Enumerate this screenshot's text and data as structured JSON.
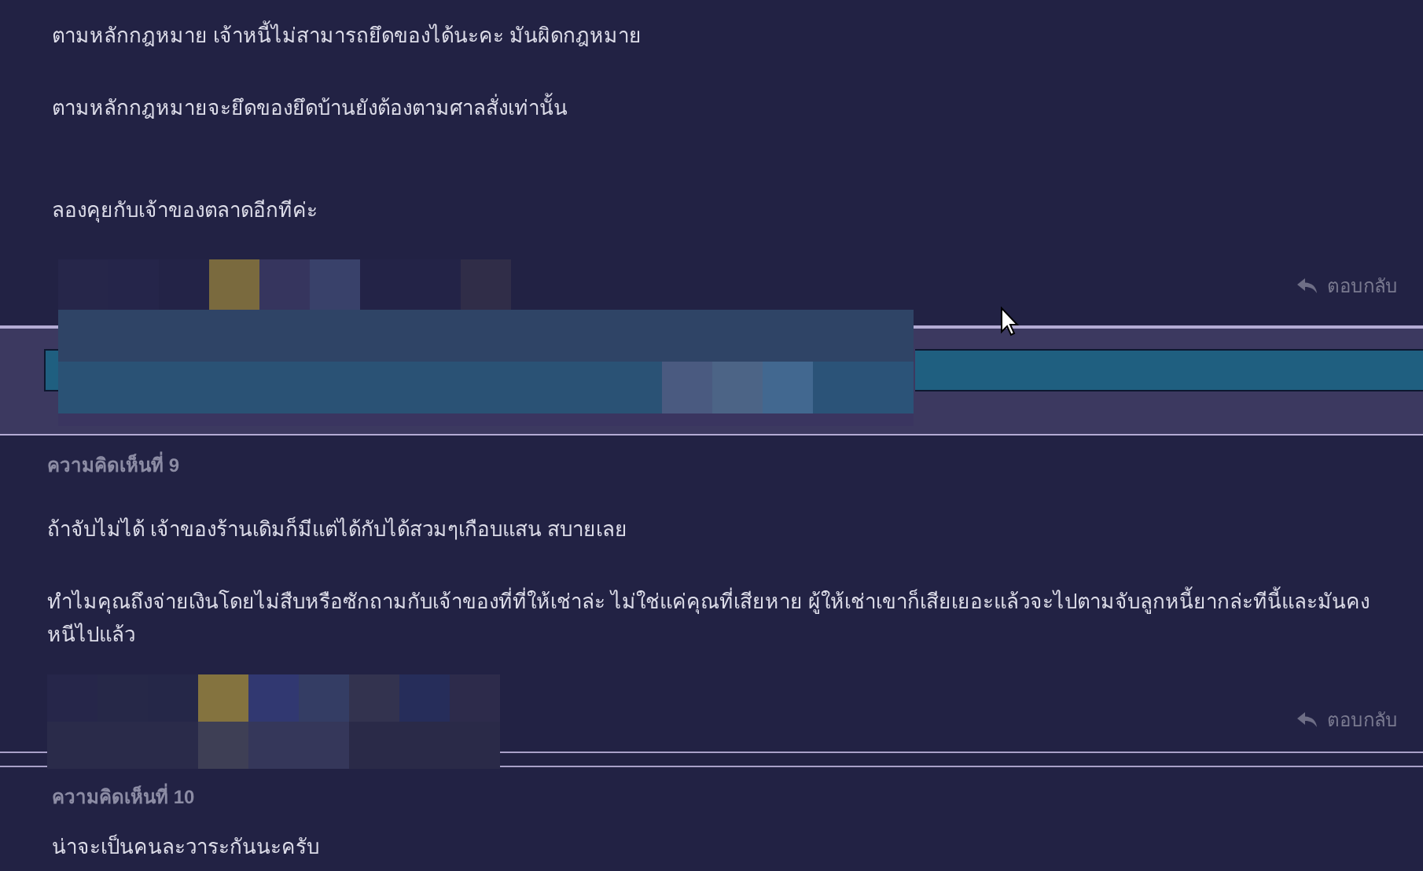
{
  "comments": [
    {
      "paragraphs": [
        "ตามหลักกฎหมาย เจ้าหนี้ไม่สามารถยึดของได้นะคะ มันผิดกฎหมาย",
        "ตามหลักกฎหมายจะยึดของยึดบ้านยังต้องตามศาลสั่งเท่านั้น",
        "ลองคุยกับเจ้าของตลาดอีกทีค่ะ"
      ],
      "reply_label": "ตอบกลับ"
    },
    {
      "header": "ความคิดเห็นที่ 9",
      "paragraphs": [
        "ถ้าจับไม่ได้ เจ้าของร้านเดิมก็มีแต่ได้กับได้สวมๆเกือบแสน สบายเลย",
        "ทำไมคุณถึงจ่ายเงินโดยไม่สืบหรือซักถามกับเจ้าของที่ที่ให้เช่าล่ะ ไม่ใช่แค่คุณที่เสียหาย ผู้ให้เช่าเขาก็เสียเยอะแล้วจะไปตามจับลูกหนี้ยากล่ะทีนี้และมันคงหนีไปแล้ว"
      ],
      "reply_label": "ตอบกลับ"
    },
    {
      "header": "ความคิดเห็นที่ 10",
      "paragraphs": [
        "น่าจะเป็นคนละวาระกันนะครับ"
      ]
    }
  ]
}
